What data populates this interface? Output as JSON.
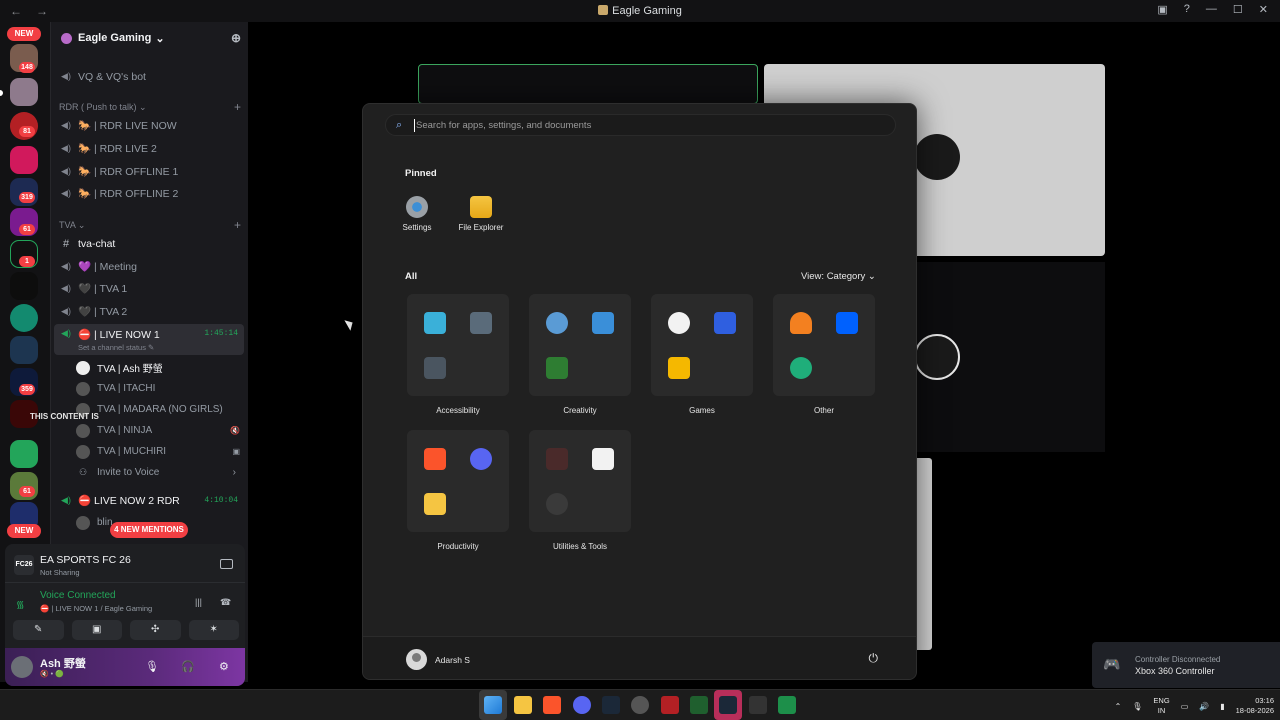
{
  "window": {
    "title": "Eagle Gaming",
    "back_glyph": "←",
    "forward_glyph": "→",
    "minimize": "—",
    "maximize": "☐",
    "close": "✕",
    "inbox_glyph": "▣",
    "help_glyph": "?"
  },
  "server_rail": {
    "new_label_top": "NEW",
    "new_label_bottom": "NEW",
    "badges": [
      "148",
      "81",
      "319",
      "61",
      "1",
      "359",
      "61"
    ]
  },
  "guild": {
    "name": "Eagle Gaming",
    "chevron": "⌄",
    "invite_glyph": "⊕"
  },
  "channels": {
    "top": "VQ & VQ's bot",
    "category_rdr": "RDR ( Push to talk)",
    "rdr_items": [
      "🐎 | RDR LIVE NOW",
      "🐎 | RDR LIVE 2",
      "🐎 | RDR OFFLINE 1",
      "🐎 | RDR OFFLINE 2"
    ],
    "category_tva": "TVA",
    "tva_text": "tva-chat",
    "tva_items": [
      "💜 | Meeting",
      "🖤 | TVA 1",
      "🖤 | TVA 2"
    ],
    "live_now": "⛔ | LIVE NOW 1",
    "live_timer": "1:45:14",
    "channel_status": "Set a channel status ✎",
    "members": [
      "TVA | Ash 野螢",
      "TVA | ITACHI",
      "TVA | MADARA (NO GIRLS)",
      "TVA | NINJA",
      "TVA | MUCHIRI"
    ],
    "invite_voice": "Invite to Voice",
    "live_now2": "⛔ LIVE NOW 2 RDR",
    "live_timer2": "4:10:04",
    "partial_member": "blin",
    "overlay_text": "THIS CONTENT IS",
    "new_mentions": "4 NEW MENTIONS"
  },
  "activity": {
    "game": "EA SPORTS FC 26",
    "status": "Not Sharing",
    "game_abbr": "FC26"
  },
  "voice": {
    "title": "Voice Connected",
    "channel": "⛔ | LIVE NOW 1 / Eagle Gaming"
  },
  "voice_buttons": [
    "✎",
    "▣",
    "✣",
    "✶"
  ],
  "user": {
    "name": "Ash 野螢",
    "status": "🔇 • 🟢",
    "mic": "🎙",
    "headset": "🎧",
    "settings": "⚙"
  },
  "start_menu": {
    "search_placeholder": "Search for apps, settings, and documents",
    "pinned_title": "Pinned",
    "pinned": [
      {
        "label": "Settings",
        "icon": "gear-icon"
      },
      {
        "label": "File Explorer",
        "icon": "folder-icon"
      }
    ],
    "all_title": "All",
    "view_label": "View: Category ⌄",
    "categories": [
      "Accessibility",
      "Creativity",
      "Games",
      "Other",
      "Productivity",
      "Utilities & Tools"
    ],
    "account_name": "Adarsh S",
    "power_glyph": "⏻"
  },
  "toast": {
    "title": "Controller Disconnected",
    "body": "Xbox 360 Controller",
    "icon": "🎮"
  },
  "tray": {
    "lang1": "ENG",
    "lang2": "IN",
    "time": "03:16",
    "date": "18-08-2026",
    "chevron": "⌃",
    "mic": "🎙",
    "net": "▭",
    "vol": "🔊",
    "batt": "▮"
  },
  "colors": {
    "accent_green": "#23a55a",
    "danger_red": "#f23f43",
    "discord_bg": "#1a1a1e",
    "start_bg": "#202020"
  }
}
